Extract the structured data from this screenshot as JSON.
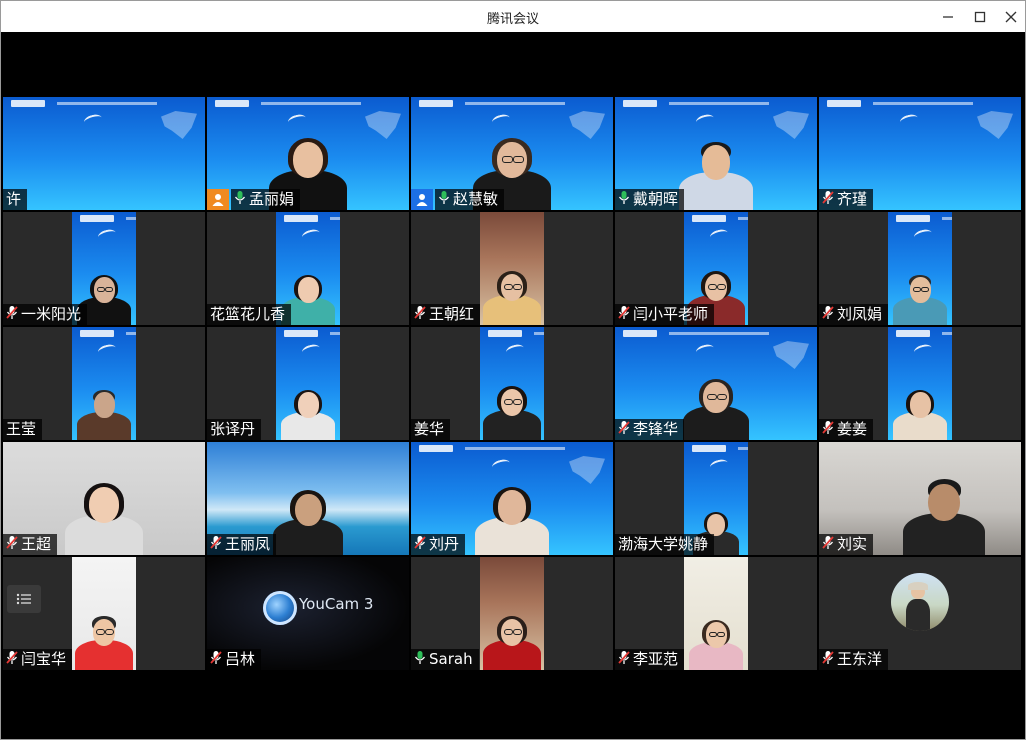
{
  "window": {
    "title": "腾讯会议",
    "controls": {
      "minimize_icon": "minimize-icon",
      "maximize_icon": "maximize-icon",
      "close_icon": "close-icon"
    }
  },
  "participants": [
    {
      "name": "许",
      "mic": "none"
    },
    {
      "name": "孟丽娟",
      "mic": "on",
      "role": "host"
    },
    {
      "name": "赵慧敏",
      "mic": "on",
      "role": "cohost"
    },
    {
      "name": "戴朝晖",
      "mic": "on"
    },
    {
      "name": "齐瑾",
      "mic": "muted"
    },
    {
      "name": "一米阳光",
      "mic": "muted"
    },
    {
      "name": "花篮花儿香",
      "mic": "none"
    },
    {
      "name": "王朝红",
      "mic": "muted"
    },
    {
      "name": "闫小平老师",
      "mic": "muted"
    },
    {
      "name": "刘凤娟",
      "mic": "muted"
    },
    {
      "name": "王莹",
      "mic": "none"
    },
    {
      "name": "张译丹",
      "mic": "none"
    },
    {
      "name": "姜华",
      "mic": "none"
    },
    {
      "name": "李锋华",
      "mic": "muted"
    },
    {
      "name": "姜姜",
      "mic": "muted"
    },
    {
      "name": "王超",
      "mic": "muted"
    },
    {
      "name": "王丽凤",
      "mic": "muted"
    },
    {
      "name": "刘丹",
      "mic": "muted"
    },
    {
      "name": "渤海大学姚静",
      "mic": "none"
    },
    {
      "name": "刘实",
      "mic": "muted"
    },
    {
      "name": "闫宝华",
      "mic": "muted"
    },
    {
      "name": "吕林",
      "mic": "muted"
    },
    {
      "name": "Sarah",
      "mic": "on"
    },
    {
      "name": "李亚范",
      "mic": "muted"
    },
    {
      "name": "王东洋",
      "mic": "muted"
    }
  ],
  "youcam": {
    "logo": "YouCam 3"
  },
  "colors": {
    "host_badge": "#f08a20",
    "cohost_badge": "#1c6fe5",
    "mic_on": "#2fbf5b",
    "mic_muted": "#e53935",
    "active_speaker_border": "#3fb26a"
  }
}
